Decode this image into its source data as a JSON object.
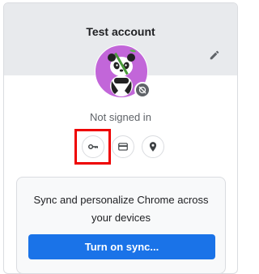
{
  "profile": {
    "account_name": "Test account",
    "status": "Not signed in"
  },
  "icons": {
    "edit": "pencil-icon",
    "passwords": "key-icon",
    "payments": "credit-card-icon",
    "addresses": "location-pin-icon",
    "avatar": "panda-avatar",
    "badge": "sync-off-icon"
  },
  "sync": {
    "description": "Sync and personalize Chrome across your devices",
    "button_label": "Turn on sync..."
  },
  "colors": {
    "header_bg": "#e8eaed",
    "avatar_bg": "#c266d9",
    "accent": "#1a73e8",
    "highlight": "#ee0000"
  }
}
